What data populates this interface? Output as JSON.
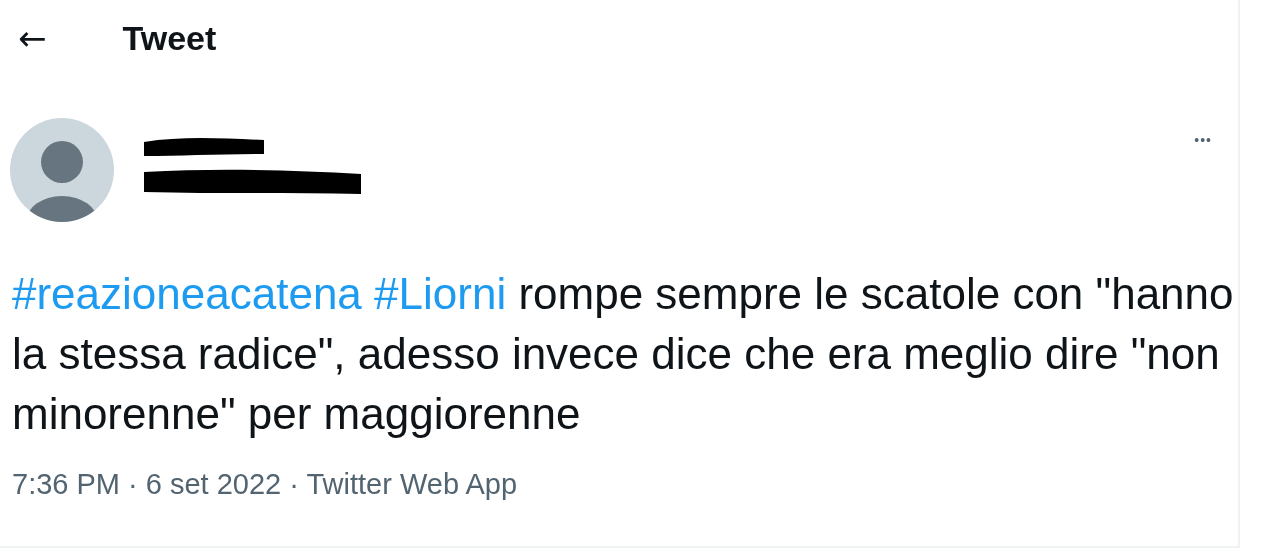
{
  "header": {
    "back_icon": "←",
    "title": "Tweet"
  },
  "tweet": {
    "author": {
      "name_redacted": true
    },
    "more_icon": "•••",
    "text": [
      {
        "kind": "hashtag",
        "text": "#reazioneacatena"
      },
      {
        "kind": "hashtag",
        "text": "#Liorni"
      },
      {
        "kind": "plain",
        "text": "rompe sempre le scatole con \"hanno la stessa radice\", adesso invece dice che era meglio dire \"non minorenne\" per maggiorenne"
      }
    ],
    "meta": "7:36 PM · 6 set 2022 · Twitter Web App"
  }
}
